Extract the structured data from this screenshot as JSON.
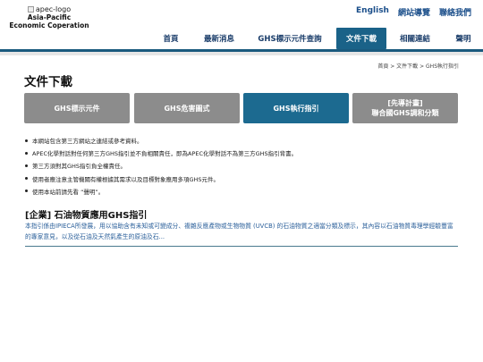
{
  "logo": {
    "alt": "apec-logo",
    "line1": "Asia-Pacific",
    "line2": "Economic Coperation"
  },
  "top_links": {
    "english": "English",
    "site_guide": "網站導覽",
    "contact": "聯絡我們"
  },
  "nav": {
    "items": [
      {
        "label": "首頁"
      },
      {
        "label": "最新消息"
      },
      {
        "label": "GHS標示元件查詢"
      },
      {
        "label": "文件下載"
      },
      {
        "label": "相關連結"
      },
      {
        "label": "聲明"
      }
    ],
    "active_index": 3
  },
  "breadcrumb": "首頁 > 文件下載 > GHS執行指引",
  "page_title": "文件下載",
  "tabs": [
    {
      "label": "GHS標示元件"
    },
    {
      "label": "GHS危害圖式"
    },
    {
      "label": "GHS執行指引"
    },
    {
      "label_line1": "[先導計畫]",
      "label_line2": "聯合國GHS調和分類"
    }
  ],
  "notes": [
    "本網站包含第三方網站之連結或參考資料。",
    "APEC化學對話對任何第三方GHS指引並不負相關責任，即為APEC化學對話不為第三方GHS指引背書。",
    "第三方須對其GHS指引負全權責任。",
    "使用者應注意主管機關有權根據其需求以及目標對象應用多項GHS元件。",
    "使用本站前請先看 “聲明”。"
  ],
  "section": {
    "heading": "[企業] 石油物質應用GHS指引",
    "description": "本指引係由IPIECA所發展，用以協助含有未知或可變成分、複雜反應產物或生物物質 (UVCB) 的石油物質之適當分類及標示，其內容以石油物質毒理學經驗豐富的專家意見，以及從石油及天然氣產生的原油及石..."
  },
  "colors": {
    "accent": "#1c6a90",
    "nav_text": "#1a3d6a",
    "link": "#1a4e8a",
    "tab_inactive": "#8c8c8c"
  }
}
